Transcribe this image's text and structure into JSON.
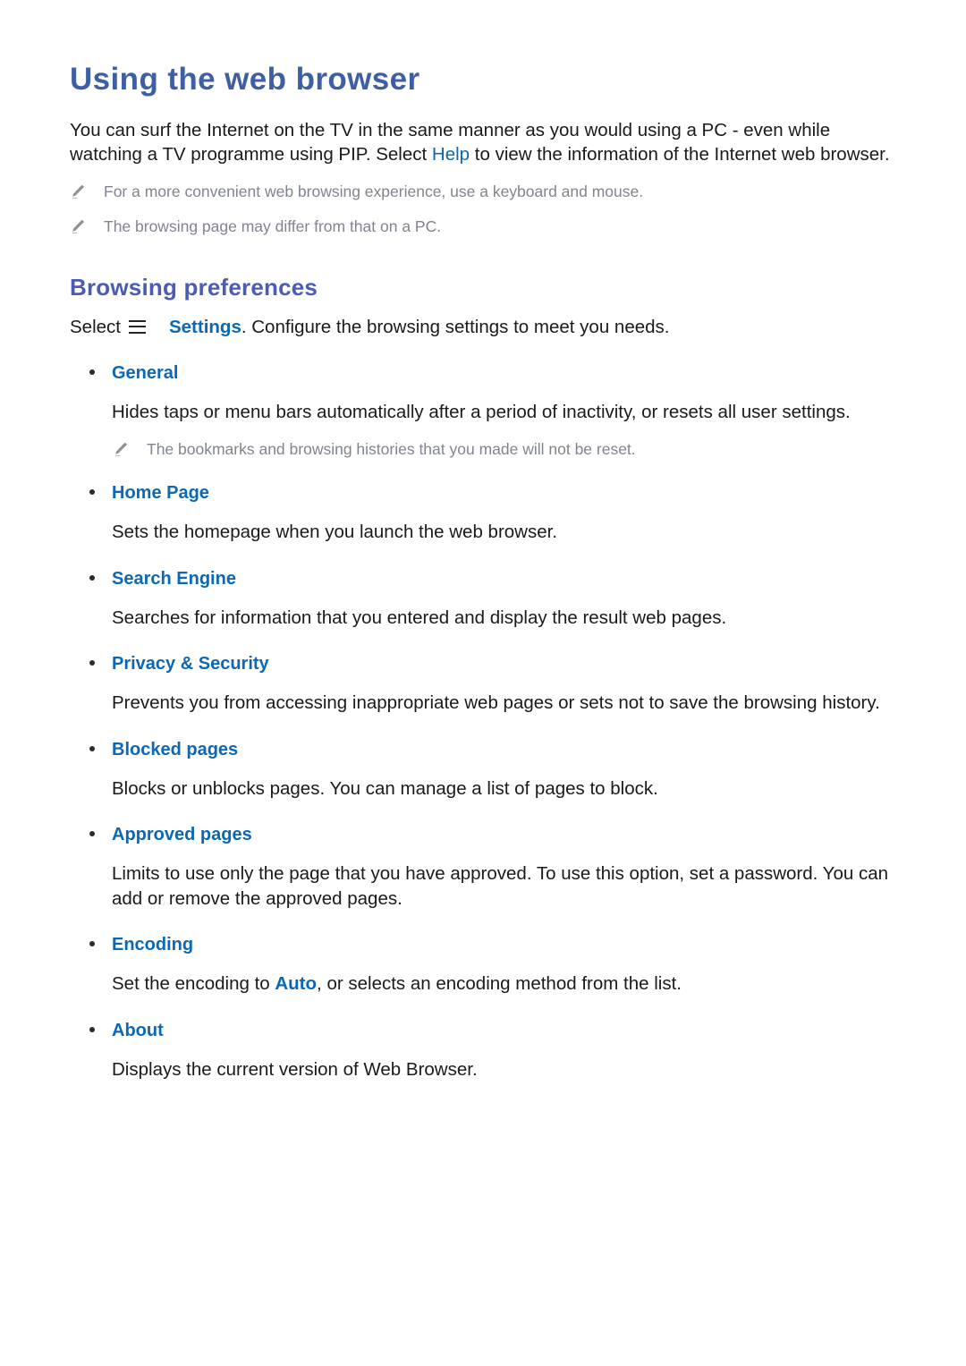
{
  "colors": {
    "title_blue": "#3f5fa4",
    "section_blue": "#4c5cb4",
    "link_blue": "#0c68b4",
    "note_grey": "#808490",
    "body_text": "#1a1a1a",
    "background": "#ffffff"
  },
  "page": {
    "title": "Using the web browser",
    "intro": {
      "before_link": "You can surf the Internet on the TV in the same manner as you would using a PC - even while watching a TV programme using PIP. Select ",
      "link": "Help",
      "after_link": " to view the information of the Internet web browser."
    },
    "notes": [
      {
        "icon": "pencil-icon",
        "text": "For a more convenient web browsing experience, use a keyboard and mouse."
      },
      {
        "icon": "pencil-icon",
        "text": "The browsing page may differ from that on a PC."
      }
    ]
  },
  "section": {
    "heading": "Browsing preferences",
    "lead": {
      "select_label": "Select",
      "menu_icon": "hamburger-menu-icon",
      "menu_link": "Settings",
      "after": ". Configure the browsing settings to meet you needs."
    },
    "options": [
      {
        "title": "General",
        "description": "Hides taps or menu bars automatically after a period of inactivity, or resets all user settings.",
        "note": {
          "icon": "pencil-icon",
          "text": "The bookmarks and browsing histories that you made will not be reset."
        }
      },
      {
        "title": "Home Page",
        "description": "Sets the homepage when you launch the web browser."
      },
      {
        "title": "Search Engine",
        "description": "Searches for information that you entered and display the result web pages."
      },
      {
        "title": "Privacy & Security",
        "description": "Prevents you from accessing inappropriate web pages or sets not to save the browsing history."
      },
      {
        "title": "Blocked pages",
        "description": "Blocks or unblocks pages. You can manage a list of pages to block."
      },
      {
        "title": "Approved pages",
        "description": "Limits to use only the page that you have approved. To use this option, set a password. You can add or remove the approved pages."
      },
      {
        "title": "Encoding",
        "desc_before": "Set the encoding to ",
        "desc_highlight": "Auto",
        "desc_after": ", or selects an encoding method from the list."
      },
      {
        "title": "About",
        "description": "Displays the current version of Web Browser."
      }
    ]
  }
}
